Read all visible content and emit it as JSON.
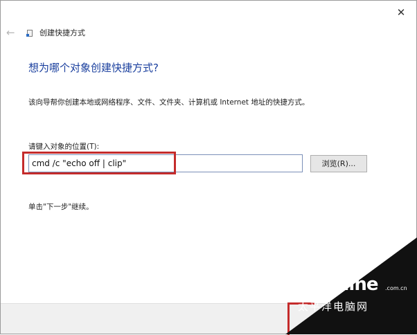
{
  "window": {
    "title": "创建快捷方式",
    "close_glyph": "✕",
    "back_glyph": "←"
  },
  "page": {
    "heading": "想为哪个对象创建快捷方式?",
    "description": "该向导帮你创建本地或网络程序、文件、文件夹、计算机或 Internet 地址的快捷方式。",
    "field_label": "请键入对象的位置(T):",
    "input_value": "cmd /c \"echo off | clip\"",
    "browse_label": "浏览(R)...",
    "hint": "单击\"下一步\"继续。"
  },
  "watermark": {
    "logo": "PConline",
    "domain": ".com.cn",
    "chinese": "太平洋电脑网"
  },
  "colors": {
    "heading": "#1a3f9e",
    "highlight": "#c42b2b"
  }
}
